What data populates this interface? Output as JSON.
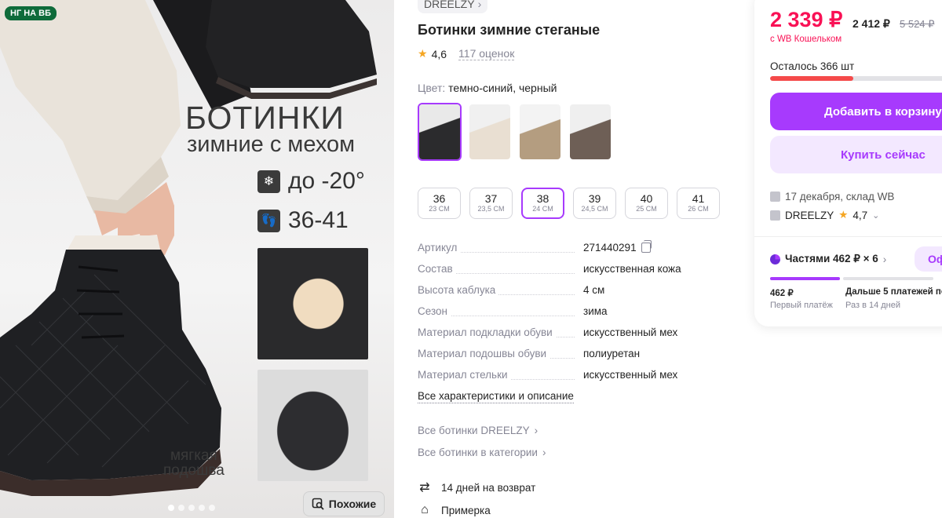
{
  "gallery": {
    "badge": "НГ НА ВБ",
    "title": "БОТИНКИ",
    "subtitle": "зимние с мехом",
    "features": [
      {
        "icon": "thermometer-snow-icon",
        "text": "до -20°"
      },
      {
        "icon": "footprints-icon",
        "text": "36-41"
      }
    ],
    "sole_line1": "мягкая",
    "sole_line2": "подошва",
    "similar_label": "Похожие",
    "slides_total": 5,
    "active_slide": 1
  },
  "product": {
    "brand": "DREELZY",
    "title": "Ботинки зимние стеганые",
    "rating": "4,6",
    "reviews": "117 оценок",
    "color_label": "Цвет:",
    "color_value": "темно-синий, черный",
    "thumbnails": [
      "черный",
      "бежевый",
      "хаки",
      "коричневый"
    ],
    "sizes": [
      {
        "ru": "36",
        "cm": "23 СМ"
      },
      {
        "ru": "37",
        "cm": "23,5 СМ"
      },
      {
        "ru": "38",
        "cm": "24 СМ"
      },
      {
        "ru": "39",
        "cm": "24,5 СМ"
      },
      {
        "ru": "40",
        "cm": "25 СМ"
      },
      {
        "ru": "41",
        "cm": "26 СМ"
      }
    ],
    "selected_size": "38",
    "specs": [
      {
        "k": "Артикул",
        "v": "271440291"
      },
      {
        "k": "Состав",
        "v": "искусственная кожа"
      },
      {
        "k": "Высота каблука",
        "v": "4 см"
      },
      {
        "k": "Сезон",
        "v": "зима"
      },
      {
        "k": "Материал подкладки обуви",
        "v": "искусственный мех"
      },
      {
        "k": "Материал подошвы обуви",
        "v": "полиуретан"
      },
      {
        "k": "Материал стельки",
        "v": "искусственный мех"
      }
    ],
    "all_chars": "Все характеристики и описание",
    "link_brand": "Все ботинки DREELZY",
    "link_category": "Все ботинки в категории",
    "return_text": "14 дней на возврат",
    "fitting_text": "Примерка"
  },
  "buy": {
    "price": "2 339 ₽",
    "price_second": "2 412 ₽",
    "price_old": "5 524 ₽",
    "wallet_note": "с WB Кошельком",
    "stock_text": "Осталось 366 шт",
    "stock_fill": 0.46,
    "add_to_cart": "Добавить в корзину",
    "buy_now": "Купить сейчас",
    "delivery": "17 декабря, склад WB",
    "seller": "DREELZY",
    "seller_rating": "4,7",
    "installments": "Частями 462 ₽ × 6",
    "installments_btn": "Оф",
    "first_payment_amount": "462 ₽",
    "first_payment_label": "Первый платёж",
    "next_payments_amount": "Дальше 5 платежей по",
    "next_payments_label": "Раз в 14 дней"
  },
  "colors": {
    "accent": "#a73afd",
    "price": "#f91155",
    "stock_bar": "#f54a4a",
    "badge_green": "#0f6b3a",
    "star": "#f5a623"
  }
}
